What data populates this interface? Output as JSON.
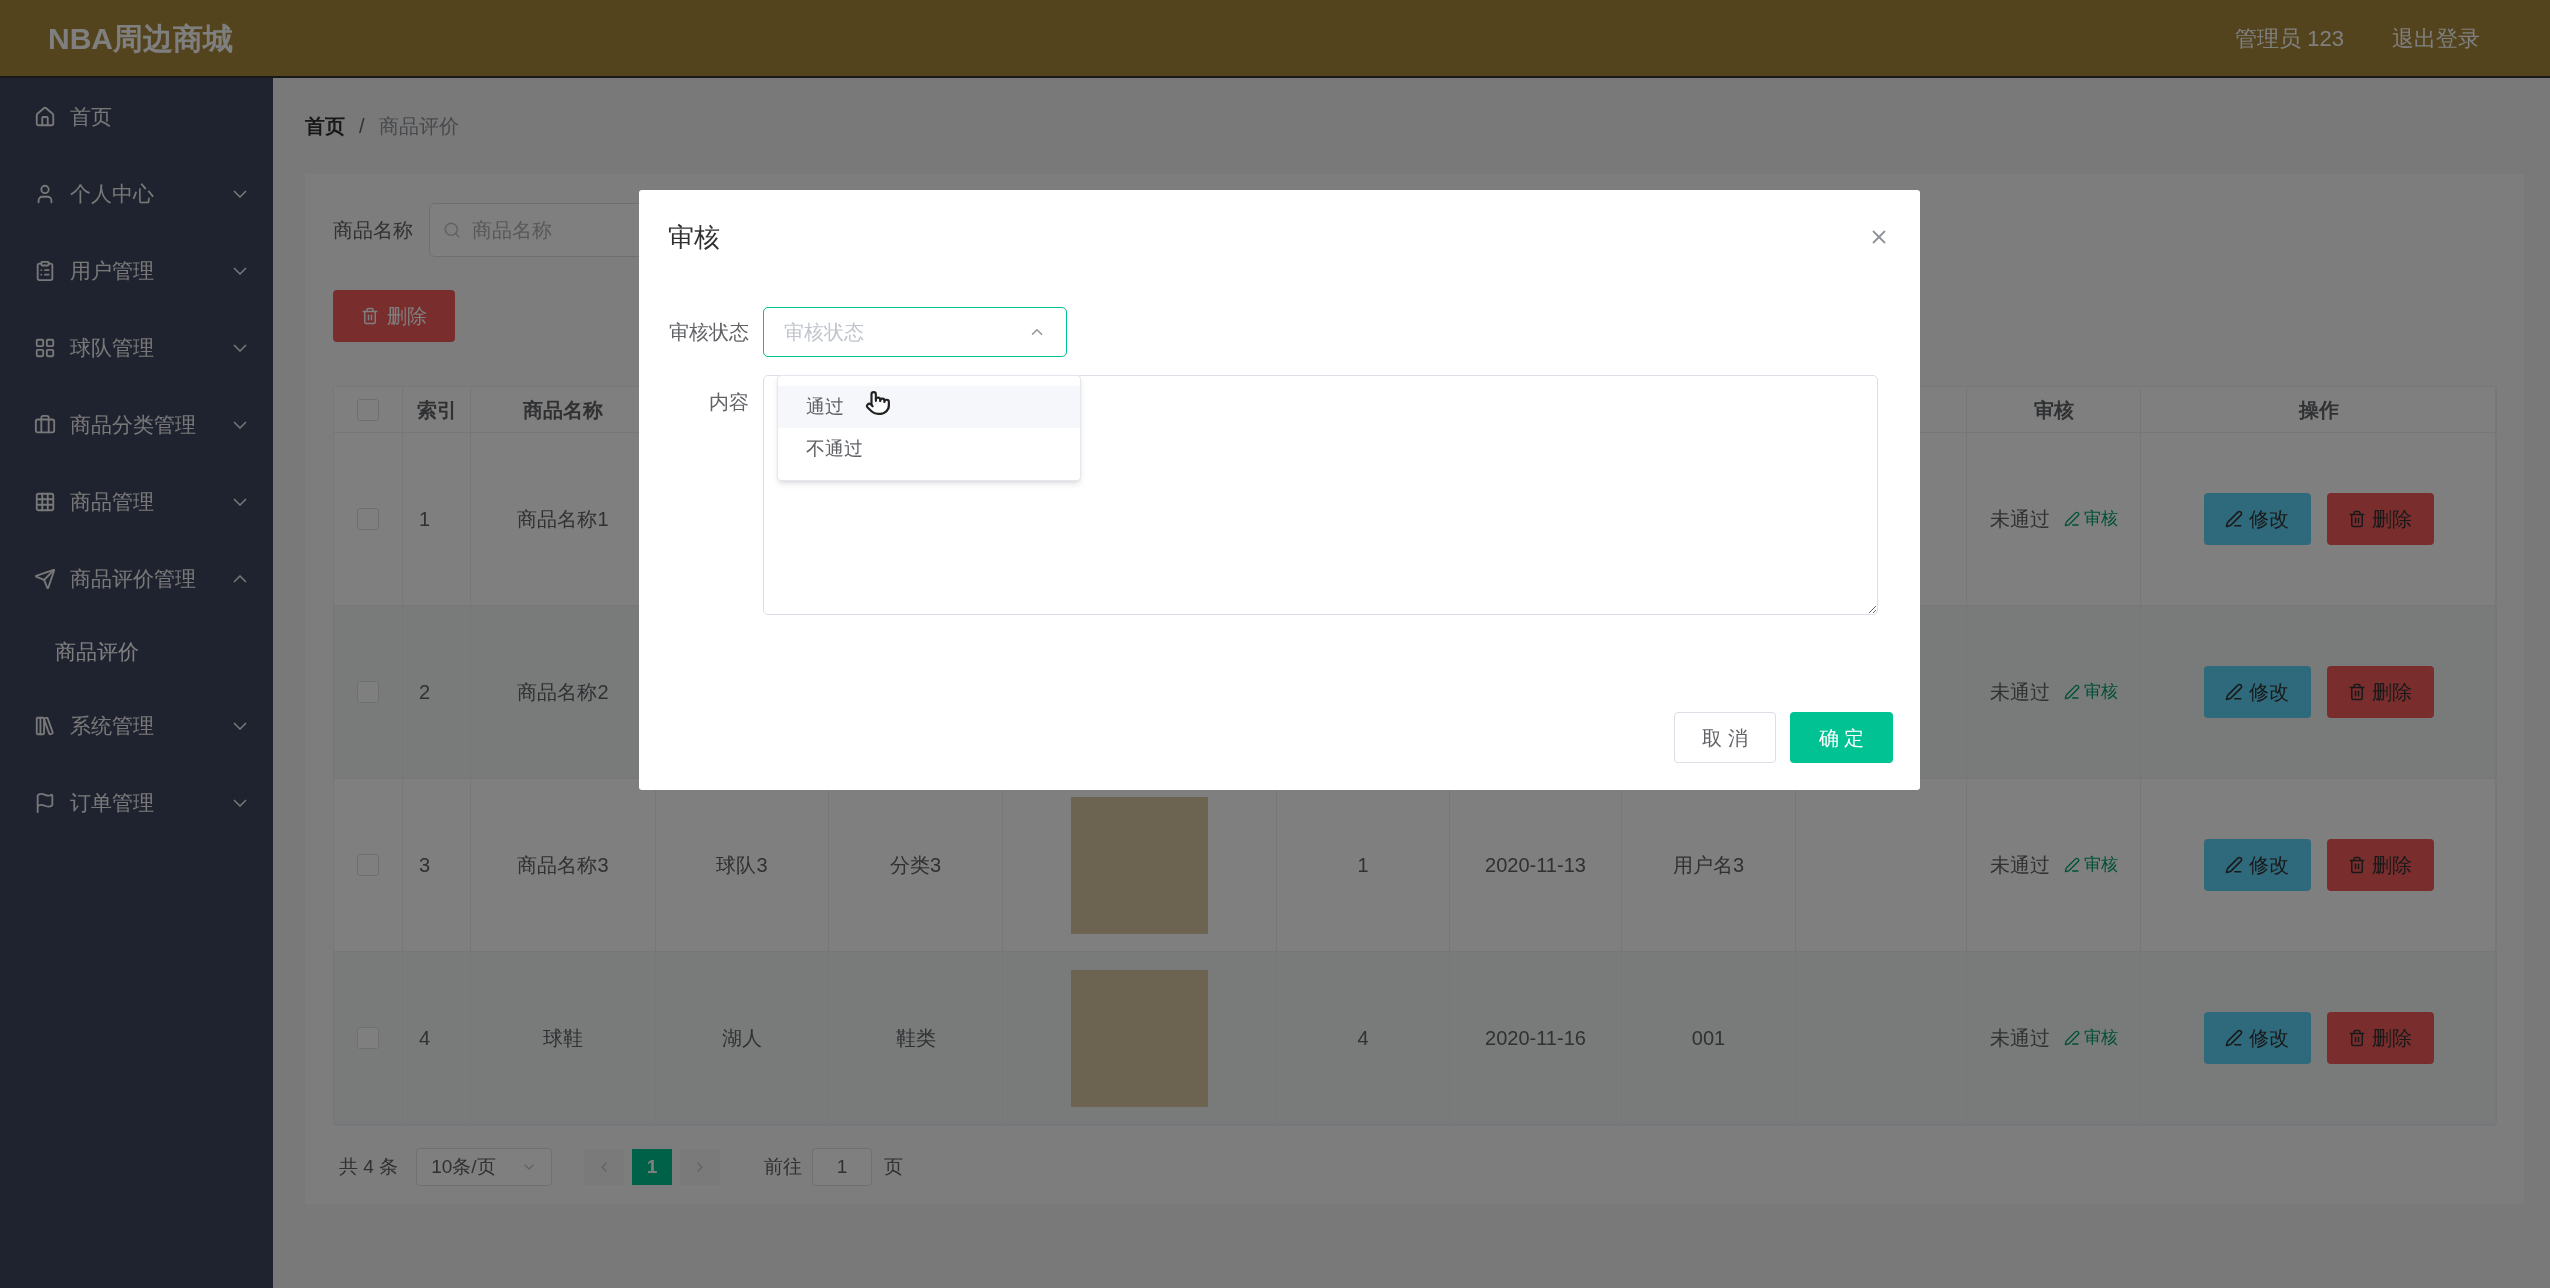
{
  "header": {
    "brand": "NBA周边商城",
    "user": "管理员 123",
    "logout": "退出登录"
  },
  "sidebar": {
    "items": [
      {
        "label": "首页",
        "expandable": false
      },
      {
        "label": "个人中心",
        "expandable": true,
        "expanded": false
      },
      {
        "label": "用户管理",
        "expandable": true,
        "expanded": false
      },
      {
        "label": "球队管理",
        "expandable": true,
        "expanded": false
      },
      {
        "label": "商品分类管理",
        "expandable": true,
        "expanded": false
      },
      {
        "label": "商品管理",
        "expandable": true,
        "expanded": false
      },
      {
        "label": "商品评价管理",
        "expandable": true,
        "expanded": true,
        "children": [
          {
            "label": "商品评价"
          }
        ]
      },
      {
        "label": "系统管理",
        "expandable": true,
        "expanded": false
      },
      {
        "label": "订单管理",
        "expandable": true,
        "expanded": false
      }
    ]
  },
  "breadcrumb": {
    "separator": "/",
    "items": [
      {
        "label": "首页",
        "current": false
      },
      {
        "label": "商品评价",
        "current": true
      }
    ]
  },
  "search": {
    "label": "商品名称",
    "placeholder": "商品名称"
  },
  "delete_button": "删除",
  "table": {
    "select_all_checked": false,
    "headers": {
      "index": "索引",
      "name": "商品名称",
      "review": "审核",
      "actions": "操作"
    },
    "rows": [
      {
        "checked": false,
        "index": "1",
        "name": "商品名称1",
        "review_status": "未通过",
        "review_link": "审核",
        "edit": "修改",
        "delete": "删除"
      },
      {
        "checked": false,
        "index": "2",
        "name": "商品名称2",
        "review_status": "未通过",
        "review_link": "审核",
        "edit": "修改",
        "delete": "删除"
      },
      {
        "checked": false,
        "index": "3",
        "name": "商品名称3",
        "team": "球队3",
        "category": "分类3",
        "has_photo": true,
        "count": "1",
        "date": "2020-11-13",
        "user": "用户名3",
        "review_status": "未通过",
        "review_link": "审核",
        "edit": "修改",
        "delete": "删除"
      },
      {
        "checked": false,
        "index": "4",
        "name": "球鞋",
        "team": "湖人",
        "category": "鞋类",
        "has_photo": true,
        "count": "4",
        "date": "2020-11-16",
        "user": "001",
        "review_status": "未通过",
        "review_link": "审核",
        "edit": "修改",
        "delete": "删除"
      }
    ]
  },
  "pagination": {
    "total": "共 4 条",
    "page_size": "10条/页",
    "pages": [
      {
        "label": "1",
        "selected": true
      }
    ],
    "goto_label": "前往",
    "goto_value": "1",
    "goto_suffix": "页"
  },
  "dialog": {
    "title": "审核",
    "status_label": "审核状态",
    "status_select": {
      "placeholder": "审核状态",
      "open": true,
      "options": [
        {
          "label": "通过",
          "highlighted": true
        },
        {
          "label": "不通过",
          "highlighted": false
        }
      ]
    },
    "content_label": "内容",
    "cancel": "取 消",
    "confirm": "确 定"
  }
}
